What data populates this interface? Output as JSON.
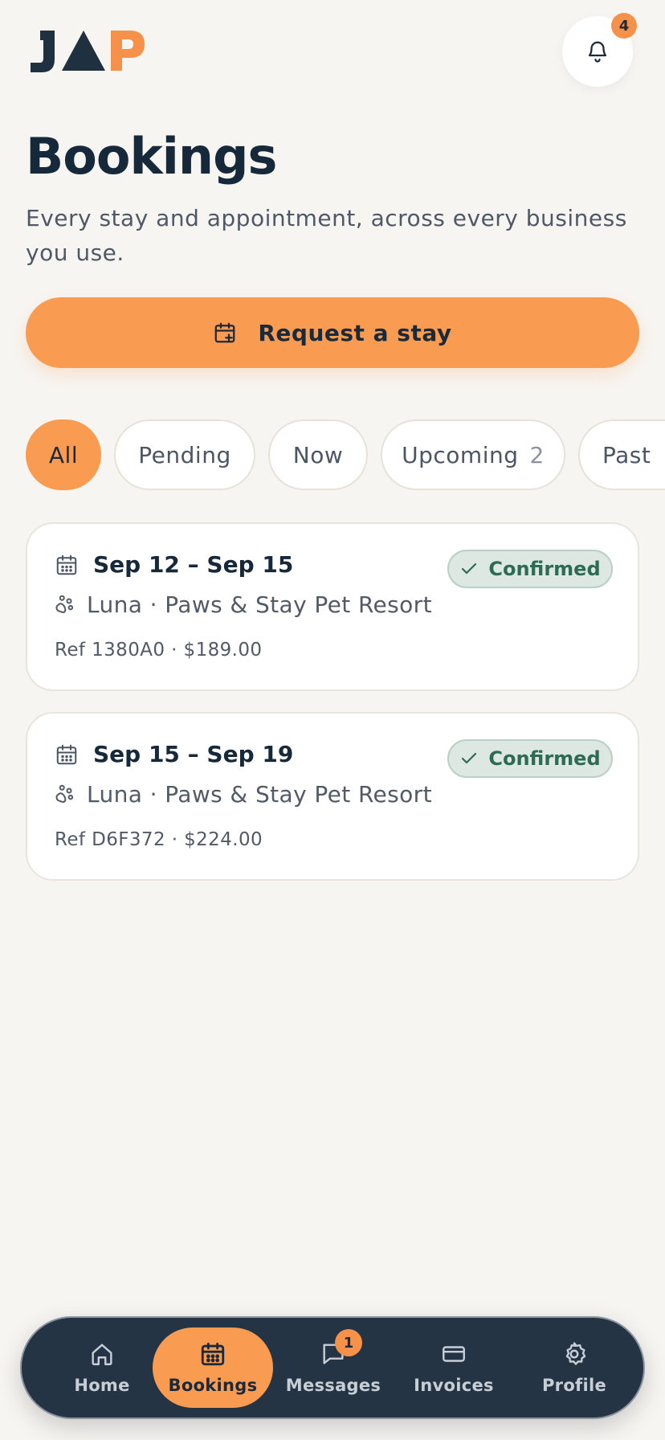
{
  "header": {
    "logo_text": "JAP",
    "notifications_count": "4"
  },
  "page": {
    "title": "Bookings",
    "subtitle": "Every stay and appointment, across every business you use.",
    "request_button_label": "Request a stay"
  },
  "filters": [
    {
      "label": "All",
      "active": true
    },
    {
      "label": "Pending",
      "active": false
    },
    {
      "label": "Now",
      "active": false
    },
    {
      "label": "Upcoming",
      "count": "2",
      "active": false
    },
    {
      "label": "Past",
      "active": false
    }
  ],
  "bookings": [
    {
      "dates": "Sep 12 – Sep 15",
      "pet_and_business": "Luna · Paws & Stay Pet Resort",
      "ref_and_price": "Ref 1380A0 · $189.00",
      "status": "Confirmed"
    },
    {
      "dates": "Sep 15 – Sep 19",
      "pet_and_business": "Luna · Paws & Stay Pet Resort",
      "ref_and_price": "Ref D6F372 · $224.00",
      "status": "Confirmed"
    }
  ],
  "bottom_nav": {
    "items": [
      {
        "label": "Home",
        "icon": "home-icon"
      },
      {
        "label": "Bookings",
        "icon": "calendar-icon",
        "active": true
      },
      {
        "label": "Messages",
        "icon": "message-icon",
        "badge": "1"
      },
      {
        "label": "Invoices",
        "icon": "card-icon"
      },
      {
        "label": "Profile",
        "icon": "gear-icon"
      }
    ]
  },
  "colors": {
    "accent": "#f99c52",
    "navy": "#16293b",
    "confirmed": "#2d6b55",
    "nav_bg": "#243444"
  }
}
